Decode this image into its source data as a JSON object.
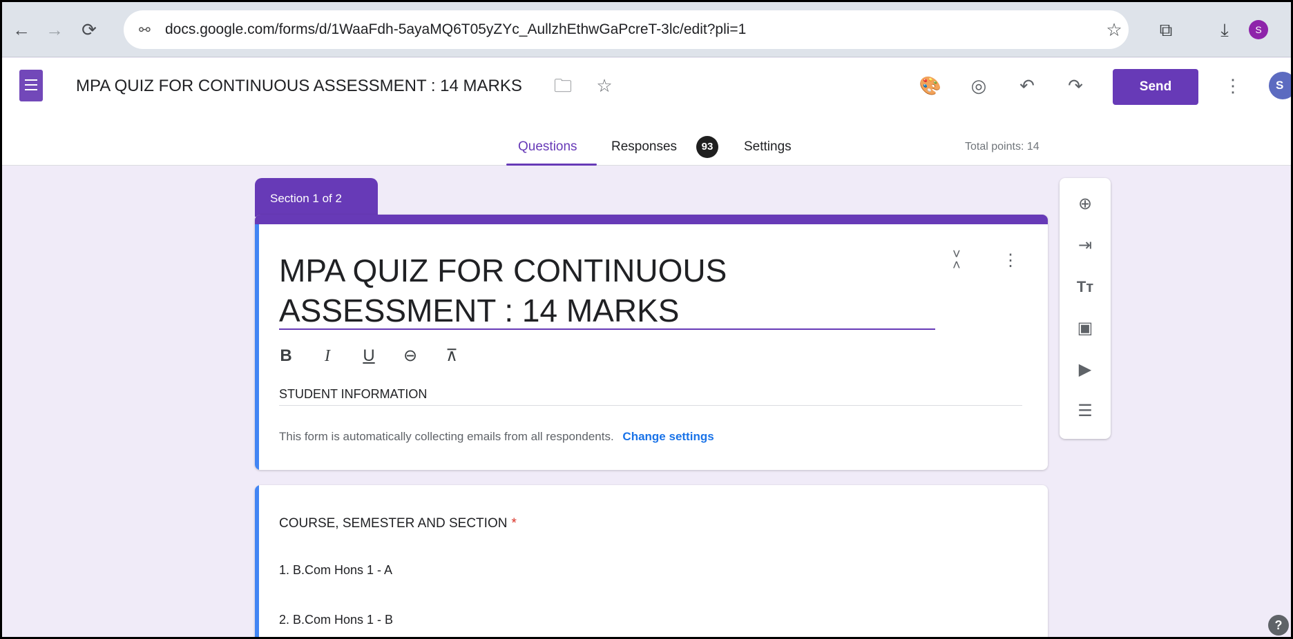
{
  "browser": {
    "url": "docs.google.com/forms/d/1WaaFdh-5ayaMQ6T05yZYc_AullzhEthwGaPcreT-3lc/edit?pli=1",
    "profile_initial": "S"
  },
  "header": {
    "doc_title": "MPA QUIZ FOR CONTINUOUS ASSESSMENT : 14 MARKS",
    "send_label": "Send",
    "avatar_initial": "S",
    "tabs": [
      {
        "label": "Questions",
        "active": true
      },
      {
        "label": "Responses",
        "badge": "93"
      },
      {
        "label": "Settings"
      }
    ],
    "total_points": "Total points: 14"
  },
  "section": {
    "tab_label": "Section 1 of 2",
    "title": "MPA QUIZ FOR CONTINUOUS ASSESSMENT : 14 MARKS",
    "description": "STUDENT INFORMATION",
    "email_notice": "This form is automatically collecting emails from all respondents.",
    "change_settings": "Change settings"
  },
  "question": {
    "title": "COURSE, SEMESTER AND SECTION",
    "required_mark": "*",
    "options": [
      "1.  B.Com Hons 1 -  A",
      "2.  B.Com Hons 1 -  B"
    ]
  },
  "colors": {
    "accent": "#673ab7",
    "background": "#f0ebf8",
    "link": "#1a73e8",
    "focus_border": "#4285f4"
  },
  "icons": {
    "format": [
      "bold-icon",
      "italic-icon",
      "underline-icon",
      "link-icon",
      "clear-format-icon"
    ],
    "toolbar": [
      "add-question-icon",
      "import-questions-icon",
      "add-title-icon",
      "add-image-icon",
      "add-video-icon",
      "add-section-icon"
    ]
  }
}
